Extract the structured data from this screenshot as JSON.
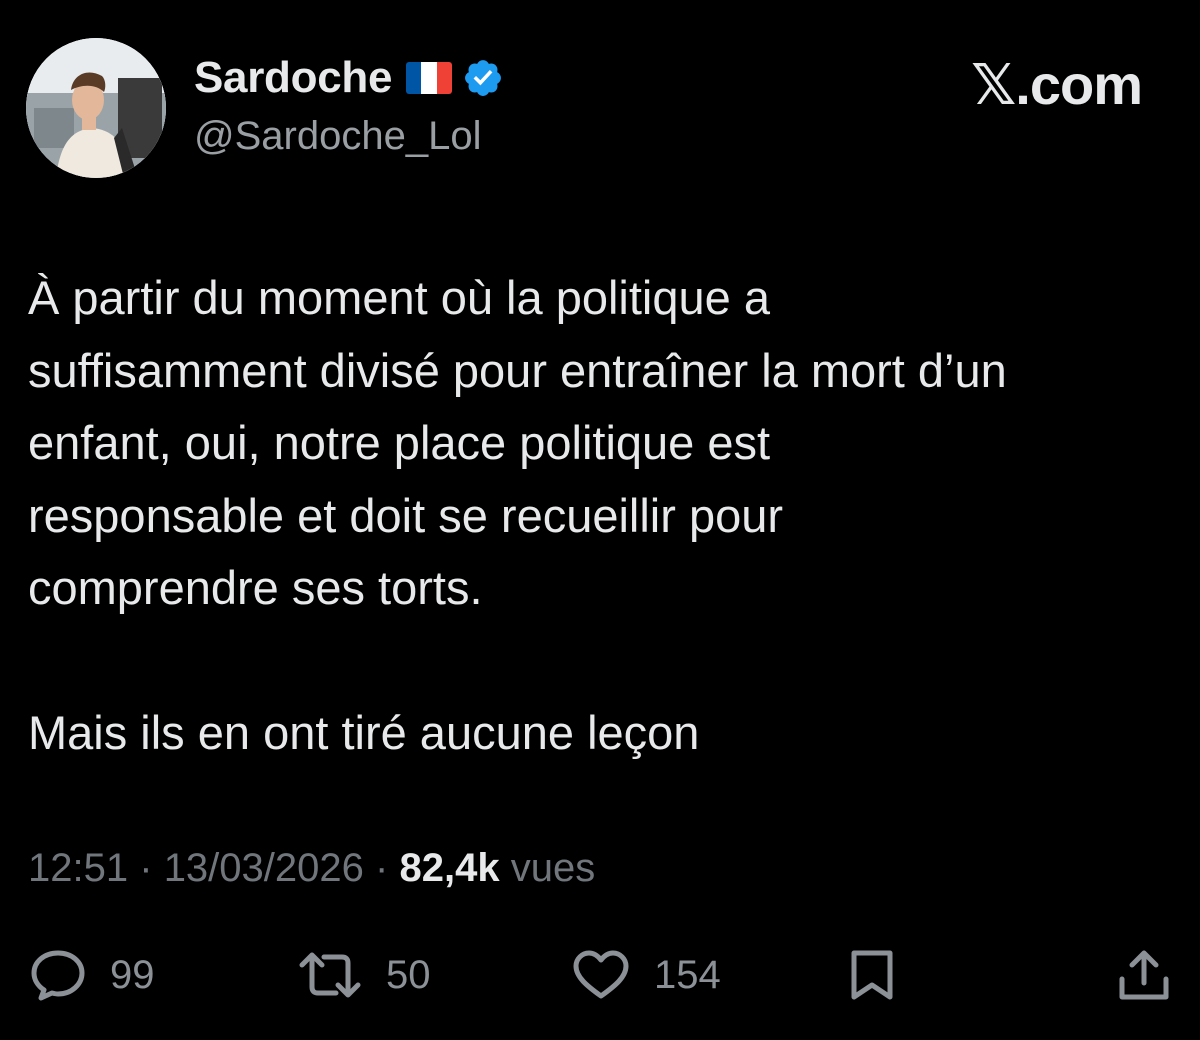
{
  "author": {
    "display_name": "Sardoche",
    "handle": "@Sardoche_Lol",
    "flag_colors": [
      "#0055A4",
      "#FFFFFF",
      "#EF4135"
    ],
    "verified_color": "#1D9BF0",
    "icons": [
      "avatar",
      "france-flag-icon",
      "verified-badge-icon"
    ]
  },
  "site": {
    "label": "𝕏.com"
  },
  "tweet": {
    "paragraphs": [
      {
        "lines": [
          "À partir du moment où la politique a",
          "suffisamment divisé pour entraîner la mort d’un",
          "enfant, oui, notre place politique est",
          "responsable et doit se recueillir pour",
          "comprendre ses torts."
        ]
      },
      {
        "lines": [
          "Mais ils en ont tiré aucune leçon"
        ]
      }
    ]
  },
  "meta": {
    "time": "12:51",
    "separator": "·",
    "date": "13/03/2026",
    "views_count": "82,4k",
    "views_label": "vues"
  },
  "actions": {
    "reply": {
      "icon": "reply-icon",
      "count": "99"
    },
    "repost": {
      "icon": "repost-icon",
      "count": "50"
    },
    "like": {
      "icon": "heart-icon",
      "count": "154"
    },
    "bookmark": {
      "icon": "bookmark-icon"
    },
    "share": {
      "icon": "share-icon"
    }
  },
  "colors": {
    "background": "#000000",
    "text": "#e7e9ea",
    "secondary": "#70767b"
  }
}
